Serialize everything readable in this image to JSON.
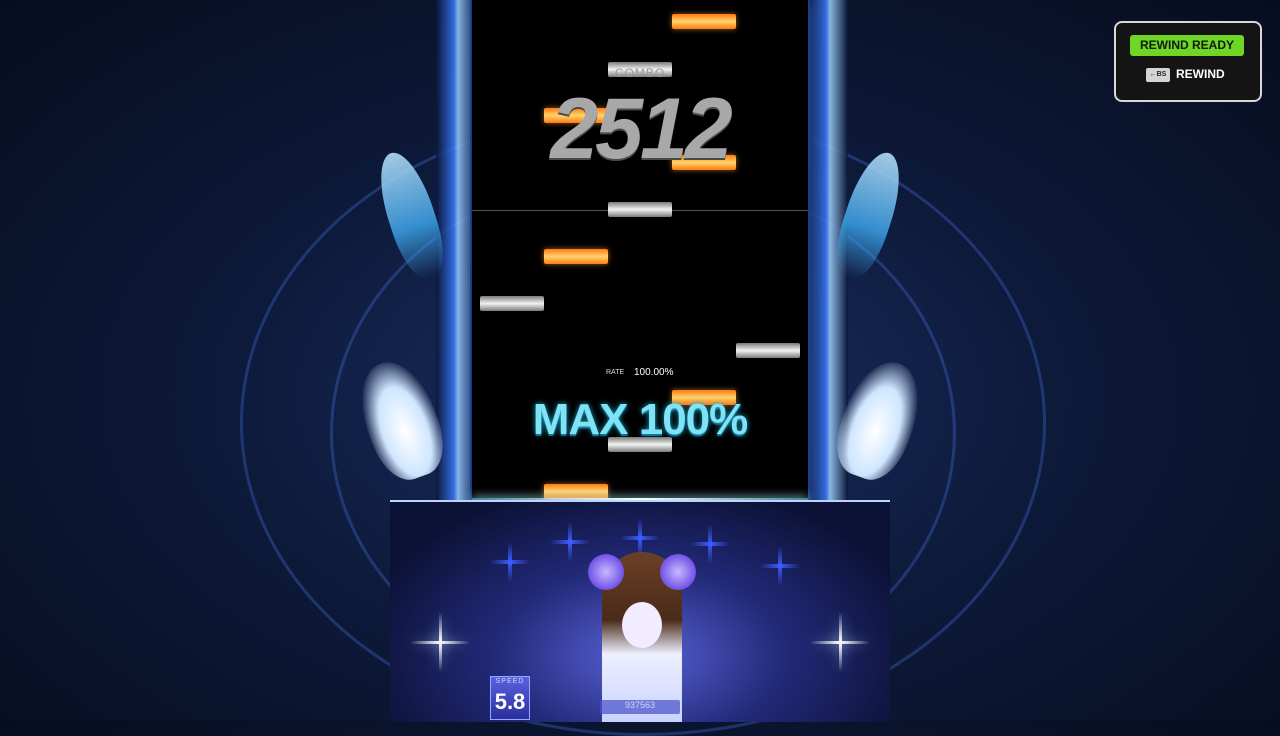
{
  "combo": {
    "label": "COMBO",
    "value": "2512"
  },
  "rate": {
    "label": "RATE",
    "value": "100.00%"
  },
  "judgement": {
    "text": "MAX 100%"
  },
  "speed": {
    "label": "SPEED",
    "value": "5.8"
  },
  "score": {
    "value": "937563"
  },
  "rewind": {
    "ready_label": "REWIND READY",
    "key_label": "←BS",
    "action_label": "REWIND"
  },
  "colors": {
    "rewind_ready_bg": "#6fd628",
    "max_text": "#7fe3f5",
    "note_orange": "#ff7a12",
    "note_white": "#f2f2f2"
  }
}
